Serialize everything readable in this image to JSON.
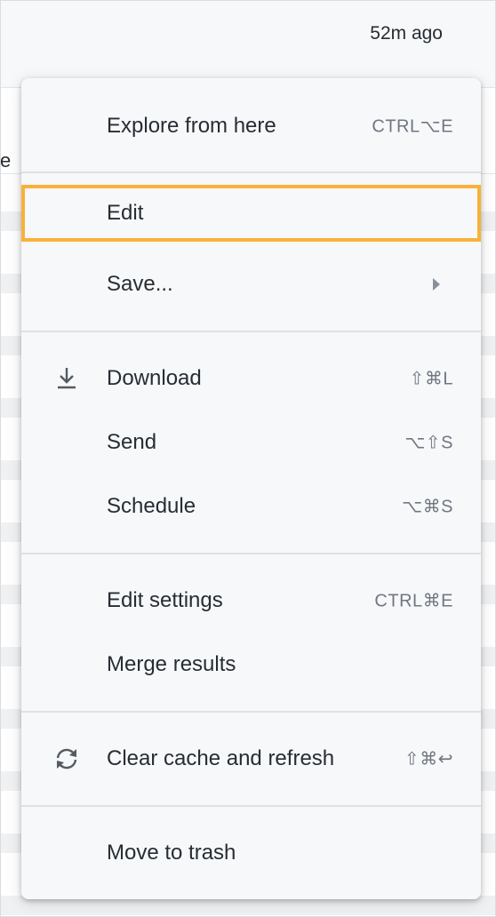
{
  "page": {
    "time_ago": "52m ago",
    "cut_text": "e"
  },
  "menu": {
    "explore": {
      "label": "Explore from here",
      "shortcut": "CTRL⌥E"
    },
    "edit": {
      "label": "Edit"
    },
    "save": {
      "label": "Save..."
    },
    "download": {
      "label": "Download",
      "shortcut": "⇧⌘L",
      "icon": "download-icon"
    },
    "send": {
      "label": "Send",
      "shortcut": "⌥⇧S"
    },
    "schedule": {
      "label": "Schedule",
      "shortcut": "⌥⌘S"
    },
    "edit_settings": {
      "label": "Edit settings",
      "shortcut": "CTRL⌘E"
    },
    "merge": {
      "label": "Merge results"
    },
    "clear_cache": {
      "label": "Clear cache and refresh",
      "shortcut": "⇧⌘↩",
      "icon": "refresh-icon"
    },
    "trash": {
      "label": "Move to trash"
    }
  },
  "colors": {
    "highlight": "#f9b13b",
    "menu_bg": "#f7f8fa",
    "text": "#262d33",
    "shortcut": "#707781"
  }
}
